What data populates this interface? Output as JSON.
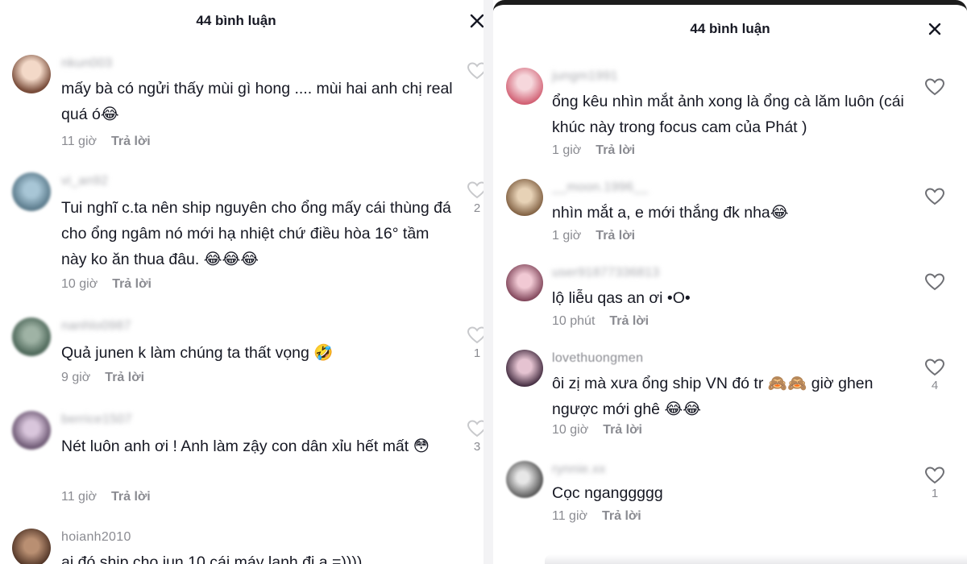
{
  "left": {
    "title": "44 bình luận",
    "comments": [
      {
        "username": "nkun003",
        "text": "mấy bà có ngửi thấy mùi gì hong .... mùi hai anh chị real quá ó",
        "emoji": "😂",
        "time": "11 giờ",
        "reply": "Trả lời",
        "likes": ""
      },
      {
        "username": "vi_an92",
        "text": "Tui nghĩ c.ta nên ship nguyên cho ổng mấy cái thùng đá cho ổng ngâm nó mới hạ nhiệt chứ điều hòa 16° tầm này ko ăn thua đâu.",
        "emoji": "😂😂😂",
        "time": "10 giờ",
        "reply": "Trả lời",
        "likes": "2"
      },
      {
        "username": "nanhlo0987",
        "text": "Quả junen k làm chúng ta thất vọng",
        "emoji": "🤣",
        "time": "9 giờ",
        "reply": "Trả lời",
        "likes": "1"
      },
      {
        "username": "berrice1507",
        "text": "Nét luôn anh ơi ! Anh làm zậy con dân xỉu hết mất",
        "emoji": "😳",
        "time": "11 giờ",
        "reply": "Trả lời",
        "likes": "3"
      },
      {
        "username": "hoianh2010",
        "text": "ai đó ship cho jun 10 cái máy lạnh đi a =))))",
        "emoji": "",
        "time": "",
        "reply": "",
        "likes": ""
      }
    ]
  },
  "right": {
    "title": "44 bình luận",
    "comments": [
      {
        "username": "jungm1991",
        "text": "ổng kêu nhìn mắt ảnh xong là ổng cà lăm luôn (cái khúc này trong focus cam của Phát )",
        "emoji": "",
        "time": "1 giờ",
        "reply": "Trả lời",
        "likes": ""
      },
      {
        "username": "__moon.1996__",
        "text": "nhìn mắt a, e mới thắng đk nha",
        "emoji": "😂",
        "time": "1 giờ",
        "reply": "Trả lời",
        "likes": ""
      },
      {
        "username": "user91877336813",
        "text": "lộ liễu qas an ơi •O•",
        "emoji": "",
        "time": "10 phút",
        "reply": "Trả lời",
        "likes": ""
      },
      {
        "username": "lovethuongmen",
        "text": "ôi zị mà xưa ổng ship VN đó tr 🙈🙈 giờ ghen ngược mới ghê",
        "emoji": "😂😂",
        "time": "10 giờ",
        "reply": "Trả lời",
        "likes": "4"
      },
      {
        "username": "rynnie.xx",
        "text": "Cọc nganggggg",
        "emoji": "",
        "time": "11 giờ",
        "reply": "Trả lời",
        "likes": "1"
      }
    ]
  },
  "colors": {
    "text": "#161823",
    "muted": "#8a8b91",
    "background": "#ffffff"
  },
  "icons": {
    "close": "close-icon",
    "like": "heart-outline-icon",
    "avatar": "user-avatar"
  }
}
